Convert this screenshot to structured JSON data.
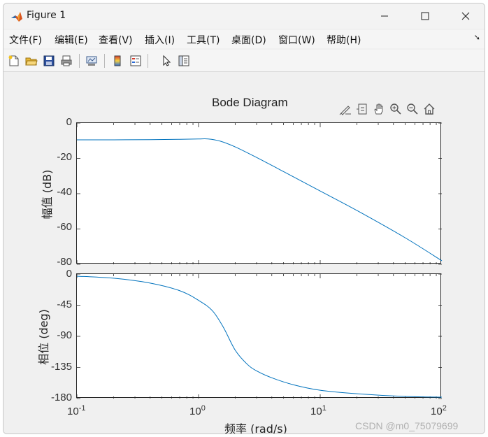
{
  "window": {
    "title": "Figure 1",
    "controls": {
      "minimize": "─",
      "maximize": "☐",
      "close": "✕"
    }
  },
  "menu": {
    "items": [
      "文件(F)",
      "编辑(E)",
      "查看(V)",
      "插入(I)",
      "工具(T)",
      "桌面(D)",
      "窗口(W)",
      "帮助(H)"
    ],
    "overflow_arrow": "➘"
  },
  "toolbar": {
    "buttons": [
      "new-figure-icon",
      "open-file-icon",
      "save-icon",
      "print-icon",
      "link-plot-icon",
      "colorbar-icon",
      "legend-icon",
      "pointer-icon",
      "property-inspector-icon"
    ]
  },
  "axes_toolbar": {
    "buttons": [
      "brush-icon",
      "data-tips-icon",
      "pan-hand-icon",
      "zoom-in-icon",
      "zoom-out-icon",
      "home-icon"
    ]
  },
  "colors": {
    "line": "#0072BD",
    "axes_border": "#262626",
    "figure_bg": "#f0f0f0"
  },
  "chart_data": [
    {
      "type": "line",
      "title": "Bode Diagram",
      "xlabel": "频率  (rad/s)",
      "ylabel": "幅值 (dB)",
      "xscale": "log",
      "xlim": [
        0.1,
        100
      ],
      "ylim": [
        -80,
        0
      ],
      "yticks": [
        0,
        -20,
        -40,
        -60,
        -80
      ],
      "ytick_labels": [
        "0",
        "-20",
        "-40",
        "-60",
        "-80"
      ],
      "x": [
        0.1,
        0.2,
        0.4,
        0.7,
        1.0,
        1.2,
        1.5,
        2.0,
        3.0,
        5.0,
        10,
        20,
        50,
        100
      ],
      "values": [
        -9.5,
        -9.5,
        -9.4,
        -9.2,
        -9.0,
        -9.0,
        -10.2,
        -13.5,
        -19.5,
        -27.5,
        -38.5,
        -49.5,
        -65,
        -78
      ]
    },
    {
      "type": "line",
      "ylabel": "相位 (deg)",
      "xscale": "log",
      "xlim": [
        0.1,
        100
      ],
      "ylim": [
        -180,
        0
      ],
      "yticks": [
        0,
        -45,
        -90,
        -135,
        -180
      ],
      "ytick_labels": [
        "0",
        "-45",
        "-90",
        "-135",
        "-180"
      ],
      "xtick_labels": [
        "10",
        "10",
        "10",
        "10"
      ],
      "xtick_exponents": [
        "-1",
        "0",
        "1",
        "2"
      ],
      "x": [
        0.1,
        0.2,
        0.4,
        0.7,
        1.0,
        1.3,
        1.6,
        2.0,
        2.5,
        3.0,
        4.0,
        6.0,
        10,
        20,
        50,
        100
      ],
      "values": [
        -3,
        -6,
        -13,
        -24,
        -38,
        -53,
        -77,
        -110,
        -130,
        -140,
        -150,
        -160,
        -168,
        -173,
        -177,
        -178
      ]
    }
  ],
  "watermark": "CSDN @m0_75079699"
}
